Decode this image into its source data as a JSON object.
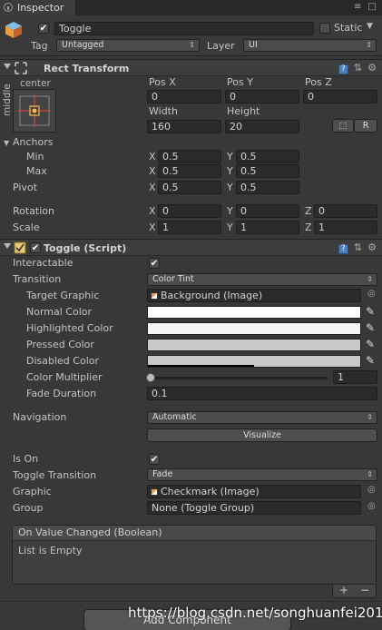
{
  "window": {
    "tab_label": "Inspector",
    "window_buttons": "≡ □"
  },
  "header": {
    "object_name": "Toggle",
    "static_label": "Static",
    "tag_label": "Tag",
    "tag_value": "Untagged",
    "layer_label": "Layer",
    "layer_value": "UI"
  },
  "rect_transform": {
    "title": "Rect Transform",
    "anchor_preset_top": "center",
    "anchor_preset_side": "middle",
    "pos_x_label": "Pos X",
    "pos_y_label": "Pos Y",
    "pos_z_label": "Pos Z",
    "pos_x": "0",
    "pos_y": "0",
    "pos_z": "0",
    "width_label": "Width",
    "height_label": "Height",
    "width": "160",
    "height": "20",
    "r_button": "R",
    "anchors_label": "Anchors",
    "min_label": "Min",
    "max_label": "Max",
    "min_x": "0.5",
    "min_y": "0.5",
    "max_x": "0.5",
    "max_y": "0.5",
    "pivot_label": "Pivot",
    "pivot_x": "0.5",
    "pivot_y": "0.5",
    "rotation_label": "Rotation",
    "rot_x": "0",
    "rot_y": "0",
    "rot_z": "0",
    "scale_label": "Scale",
    "scale_x": "1",
    "scale_y": "1",
    "scale_z": "1",
    "x": "X",
    "y": "Y",
    "z": "Z"
  },
  "toggle_script": {
    "title": "Toggle (Script)",
    "interactable_label": "Interactable",
    "interactable_checked": "✔",
    "transition_label": "Transition",
    "transition_value": "Color Tint",
    "target_graphic_label": "Target Graphic",
    "target_graphic_value": "Background (Image)",
    "normal_color_label": "Normal Color",
    "highlighted_color_label": "Highlighted Color",
    "pressed_color_label": "Pressed Color",
    "disabled_color_label": "Disabled Color",
    "color_multiplier_label": "Color Multiplier",
    "color_multiplier_value": "1",
    "fade_duration_label": "Fade Duration",
    "fade_duration_value": "0.1",
    "navigation_label": "Navigation",
    "navigation_value": "Automatic",
    "visualize_button": "Visualize",
    "is_on_label": "Is On",
    "is_on_checked": "✔",
    "toggle_transition_label": "Toggle Transition",
    "toggle_transition_value": "Fade",
    "graphic_label": "Graphic",
    "graphic_value": "Checkmark (Image)",
    "group_label": "Group",
    "group_value": "None (Toggle Group)",
    "event_header": "On Value Changed (Boolean)",
    "event_empty": "List is Empty",
    "add_symbol": "+",
    "remove_symbol": "−"
  },
  "colors": {
    "normal": "#ffffff",
    "highlighted": "#f5f5f5",
    "pressed": "#c8c8c8",
    "disabled": "#c8c8c8"
  },
  "footer": {
    "add_component": "Add Component",
    "watermark": "https://blog.csdn.net/songhuanfei2017"
  }
}
